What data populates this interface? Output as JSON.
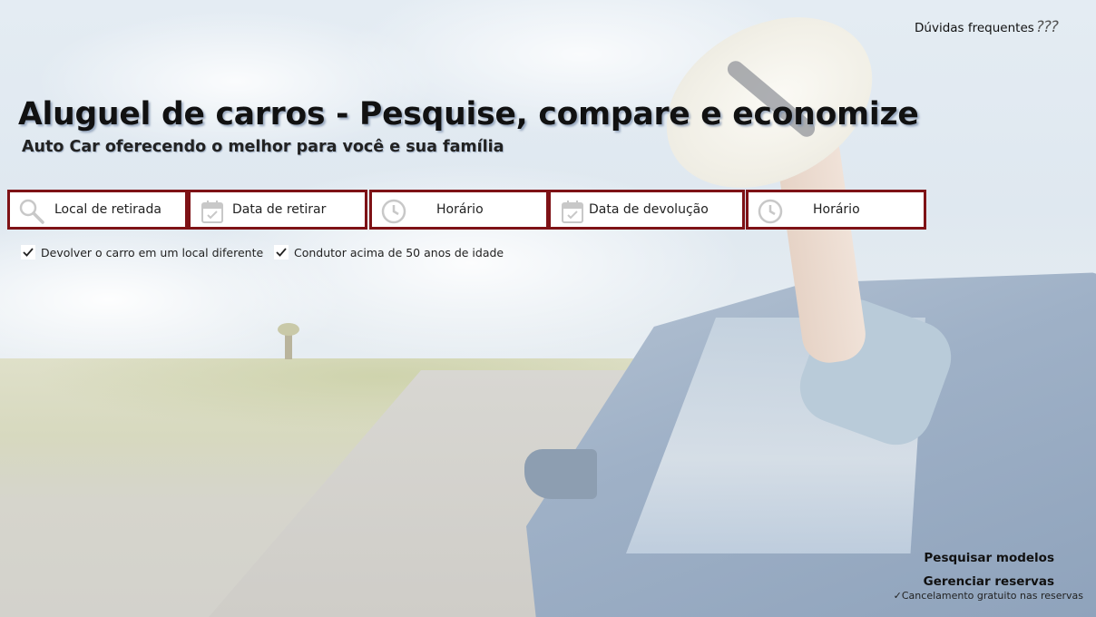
{
  "header": {
    "faq_label": "Dúvidas frequentes",
    "faq_marks": "???"
  },
  "hero": {
    "title": "Aluguel de carros - Pesquise, compare e economize",
    "subtitle": "Auto Car oferecendo o melhor para você e sua família"
  },
  "search": {
    "fields": [
      {
        "label": "Local de retirada",
        "icon": "search-icon"
      },
      {
        "label": "Data de retirar",
        "icon": "calendar-icon"
      },
      {
        "label": "Horário",
        "icon": "clock-icon"
      },
      {
        "label": "Data de devolução",
        "icon": "calendar-icon"
      },
      {
        "label": "Horário",
        "icon": "clock-icon"
      }
    ],
    "options": [
      {
        "label": "Devolver o carro em um local diferente",
        "checked": true
      },
      {
        "label": "Condutor acima de 50 anos de idade",
        "checked": true
      }
    ]
  },
  "footer_links": {
    "search_models": "Pesquisar modelos",
    "manage_bookings": "Gerenciar reservas",
    "free_cancellation": "Cancelamento gratuito nas reservas"
  },
  "colors": {
    "field_border": "#7e1216",
    "text": "#111111"
  }
}
